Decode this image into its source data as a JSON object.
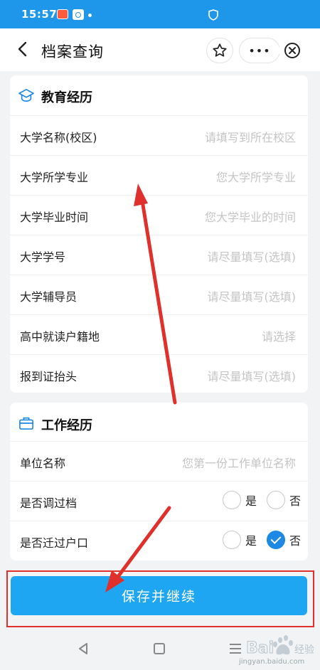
{
  "status_bar": {
    "time": "15:57"
  },
  "nav": {
    "title": "档案查询",
    "more_label": "•••"
  },
  "education": {
    "title": "教育经历",
    "rows": [
      {
        "label": "大学名称(校区)",
        "placeholder": "请填写到所在校区"
      },
      {
        "label": "大学所学专业",
        "placeholder": "您大学所学专业"
      },
      {
        "label": "大学毕业时间",
        "placeholder": "您大学毕业的时间"
      },
      {
        "label": "大学学号",
        "placeholder": "请尽量填写(选填)"
      },
      {
        "label": "大学辅导员",
        "placeholder": "请尽量填写(选填)"
      },
      {
        "label": "高中就读户籍地",
        "placeholder": "请选择"
      },
      {
        "label": "报到证抬头",
        "placeholder": "请尽量填写(选填)"
      }
    ]
  },
  "work": {
    "title": "工作经历",
    "company_label": "单位名称",
    "company_placeholder": "您第一份工作单位名称",
    "q1": {
      "label": "是否调过档",
      "yes": "是",
      "no": "否",
      "selected": "none"
    },
    "q2": {
      "label": "是否迁过户口",
      "yes": "是",
      "no": "否",
      "selected": "否"
    }
  },
  "save_button": "保存并继续",
  "watermark": {
    "text": "jingyan.baidu.com"
  },
  "colors": {
    "accent": "#1ea6f2",
    "status_bar": "#1e97ea",
    "annotation_red": "#e0302b"
  }
}
